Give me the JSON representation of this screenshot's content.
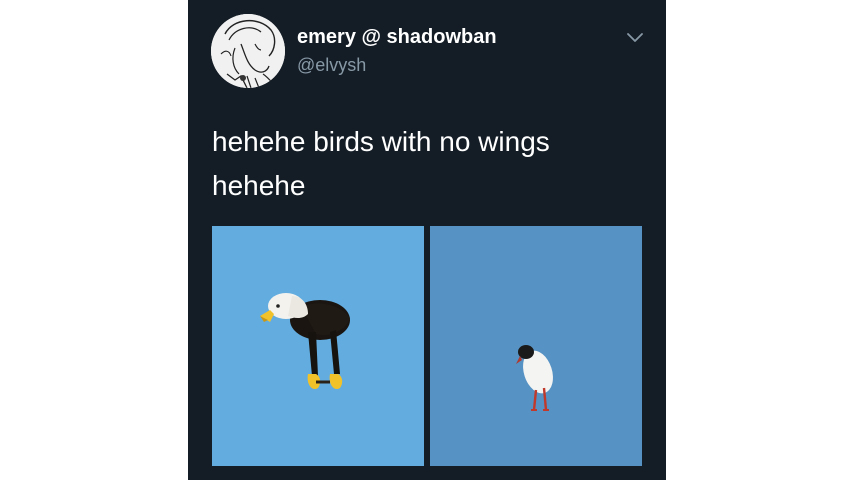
{
  "tweet": {
    "author_name": "emery @ shadowban",
    "handle": "@elvysh",
    "text_line1": "hehehe birds with no wings",
    "text_line2": "hehehe"
  },
  "icons": {
    "menu": "chevron-down-icon"
  },
  "media": [
    {
      "subject": "bald-eagle-without-wings",
      "background": "#62acdf"
    },
    {
      "subject": "gull-without-wings",
      "background": "#5692c4"
    }
  ],
  "colors": {
    "background": "#141d26",
    "text": "#ffffff",
    "secondary": "#8899a6"
  }
}
